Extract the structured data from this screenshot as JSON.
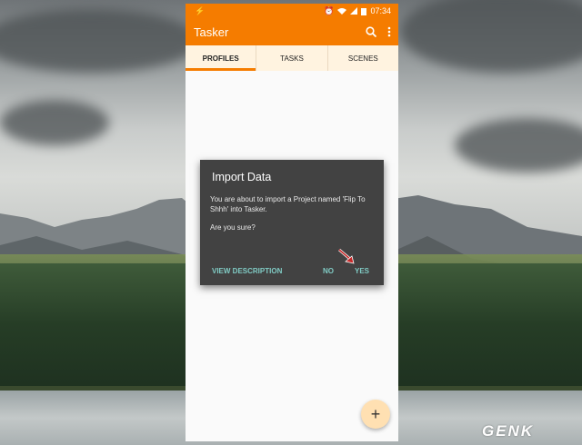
{
  "status_bar": {
    "left_icon": "bolt-icon",
    "icons": [
      "alarm-icon",
      "wifi-icon",
      "signal-icon",
      "battery-icon"
    ],
    "time": "07:34"
  },
  "app_bar": {
    "title": "Tasker",
    "icons": [
      "search-icon",
      "overflow-menu-icon"
    ],
    "color": "#f57c00"
  },
  "tabs": [
    {
      "label": "PROFILES",
      "active": true
    },
    {
      "label": "TASKS",
      "active": false
    },
    {
      "label": "SCENES",
      "active": false
    }
  ],
  "dialog": {
    "title": "Import Data",
    "message": "You are about to import a Project named 'Flip To Shhh' into Tasker.",
    "question": "Are you sure?",
    "buttons": {
      "view_description": "VIEW DESCRIPTION",
      "no": "NO",
      "yes": "YES"
    },
    "button_color": "#80cbc4",
    "background": "#424242"
  },
  "fab": {
    "label": "+"
  },
  "watermark": "GENK"
}
